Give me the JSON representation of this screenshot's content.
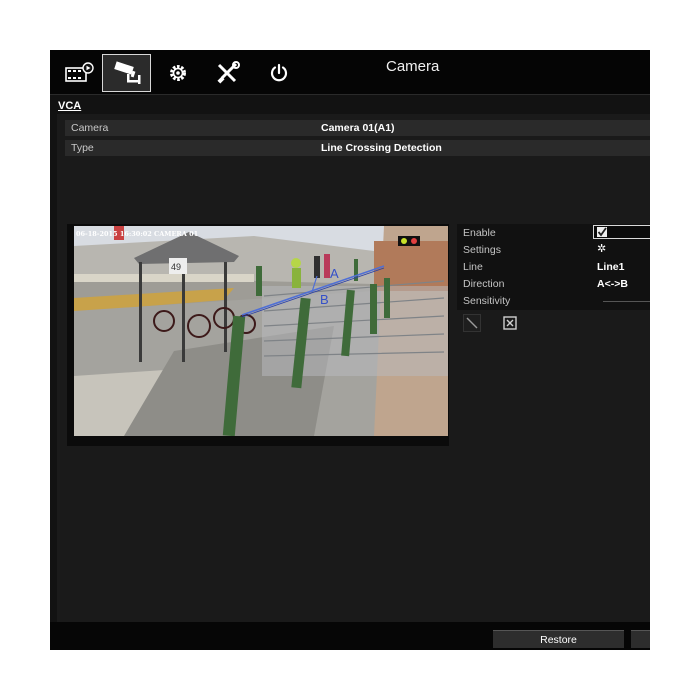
{
  "window": {
    "title": "Camera"
  },
  "nav": [
    {
      "name": "playback-icon"
    },
    {
      "name": "camera-icon"
    },
    {
      "name": "gear-icon"
    },
    {
      "name": "tools-icon"
    },
    {
      "name": "power-icon"
    }
  ],
  "section": {
    "label": "VCA"
  },
  "form": {
    "camera": {
      "label": "Camera",
      "value": "Camera 01(A1)"
    },
    "type": {
      "label": "Type",
      "value": "Line Crossing Detection"
    }
  },
  "video": {
    "osd": "06-18-2015 16:30:02 CAMERA 01",
    "sign_text": "49",
    "line_label_a": "A",
    "line_label_b": "B"
  },
  "settings": {
    "enable": {
      "label": "Enable",
      "checked": true
    },
    "settings": {
      "label": "Settings",
      "icon": "gear-icon"
    },
    "line": {
      "label": "Line",
      "value": "Line1"
    },
    "direction": {
      "label": "Direction",
      "value": "A<->B"
    },
    "sensitivity": {
      "label": "Sensitivity"
    }
  },
  "tools": [
    {
      "name": "draw-line-icon"
    },
    {
      "name": "clear-icon"
    }
  ],
  "footer": {
    "restore_label": "Restore"
  }
}
